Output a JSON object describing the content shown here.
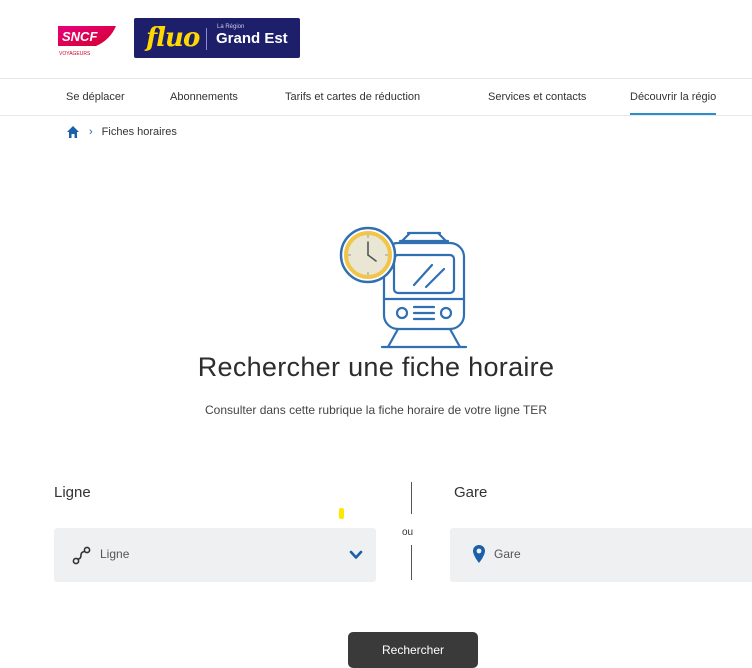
{
  "header": {
    "sncf_logo_text": "SNCF",
    "sncf_logo_sub": "VOYAGEURS",
    "fluo_logo_text": "fluo",
    "region_small": "La Région",
    "region_name": "Grand Est"
  },
  "nav": {
    "items": [
      {
        "label": "Se déplacer"
      },
      {
        "label": "Abonnements"
      },
      {
        "label": "Tarifs et cartes de réduction"
      },
      {
        "label": "Services et contacts"
      },
      {
        "label": "Découvrir la régio"
      }
    ]
  },
  "breadcrumb": {
    "current": "Fiches horaires"
  },
  "main": {
    "title": "Rechercher une fiche horaire",
    "subtitle": "Consulter dans cette rubrique la fiche horaire de votre ligne TER"
  },
  "form": {
    "ligne_label": "Ligne",
    "ligne_value": "Ligne",
    "gare_label": "Gare",
    "gare_placeholder": "Gare",
    "separator": "ou",
    "submit_label": "Rechercher"
  },
  "colors": {
    "sncf_red": "#d4002a",
    "fluo_navy": "#1e1f6b",
    "fluo_yellow": "#ffd800",
    "accent_blue": "#1b5fa8",
    "nav_active": "#2a8fcf",
    "button_dark": "#3a3a3a"
  },
  "icons": {
    "home": "home-icon",
    "breadcrumb_sep": "chevron-right-icon",
    "ligne": "route-icon",
    "dropdown": "chevron-down-icon",
    "gare": "location-pin-icon",
    "hero": "train-clock-illustration"
  }
}
